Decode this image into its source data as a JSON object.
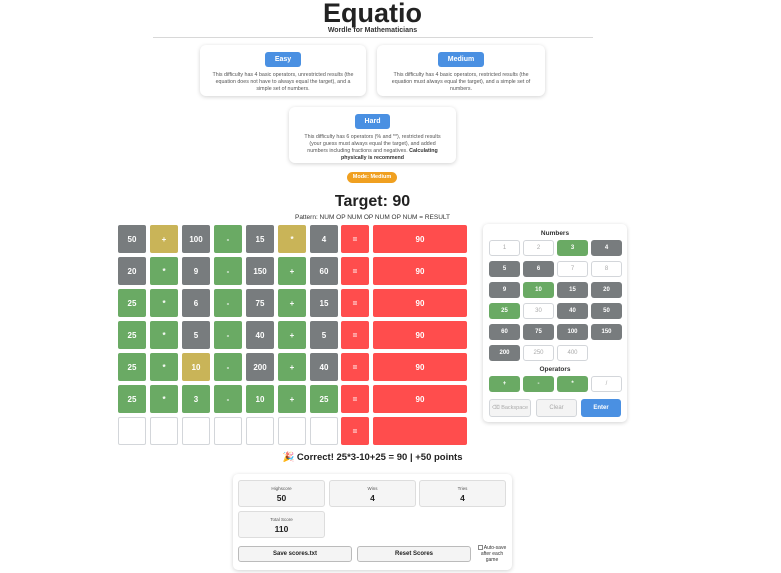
{
  "header": {
    "title": "Equatio",
    "subtitle": "Wordle for Mathematicians"
  },
  "difficulties": [
    {
      "label": "Easy",
      "description": "This difficulty has 4 basic operators, unrestricted results (the equation does not have to always equal the target), and a simple set of numbers.",
      "note": ""
    },
    {
      "label": "Medium",
      "description": "This difficulty has 4 basic operators, restricted results (the equation must always equal the target), and a simple set of numbers.",
      "note": ""
    },
    {
      "label": "Hard",
      "description": "This difficulty has 6 operators (% and **), restricted results (your guess must always equal the target), and added numbers including fractions and negatives.",
      "note": "Calculating physically is recommend"
    }
  ],
  "mode_badge": "Mode: Medium",
  "target_text": "Target: 90",
  "pattern_text": "Pattern: NUM OP NUM OP NUM OP NUM = RESULT",
  "board": {
    "rows": [
      {
        "cells": [
          {
            "v": "50",
            "s": "gray"
          },
          {
            "v": "+",
            "s": "yellow"
          },
          {
            "v": "100",
            "s": "gray"
          },
          {
            "v": "-",
            "s": "green"
          },
          {
            "v": "15",
            "s": "gray"
          },
          {
            "v": "*",
            "s": "yellow"
          },
          {
            "v": "4",
            "s": "gray"
          }
        ],
        "eq": "=",
        "result": "90"
      },
      {
        "cells": [
          {
            "v": "20",
            "s": "gray"
          },
          {
            "v": "*",
            "s": "green"
          },
          {
            "v": "9",
            "s": "gray"
          },
          {
            "v": "-",
            "s": "green"
          },
          {
            "v": "150",
            "s": "gray"
          },
          {
            "v": "+",
            "s": "green"
          },
          {
            "v": "60",
            "s": "gray"
          }
        ],
        "eq": "=",
        "result": "90"
      },
      {
        "cells": [
          {
            "v": "25",
            "s": "green"
          },
          {
            "v": "*",
            "s": "green"
          },
          {
            "v": "6",
            "s": "gray"
          },
          {
            "v": "-",
            "s": "green"
          },
          {
            "v": "75",
            "s": "gray"
          },
          {
            "v": "+",
            "s": "green"
          },
          {
            "v": "15",
            "s": "gray"
          }
        ],
        "eq": "=",
        "result": "90"
      },
      {
        "cells": [
          {
            "v": "25",
            "s": "green"
          },
          {
            "v": "*",
            "s": "green"
          },
          {
            "v": "5",
            "s": "gray"
          },
          {
            "v": "-",
            "s": "green"
          },
          {
            "v": "40",
            "s": "gray"
          },
          {
            "v": "+",
            "s": "green"
          },
          {
            "v": "5",
            "s": "gray"
          }
        ],
        "eq": "=",
        "result": "90"
      },
      {
        "cells": [
          {
            "v": "25",
            "s": "green"
          },
          {
            "v": "*",
            "s": "green"
          },
          {
            "v": "10",
            "s": "yellow"
          },
          {
            "v": "-",
            "s": "green"
          },
          {
            "v": "200",
            "s": "gray"
          },
          {
            "v": "+",
            "s": "green"
          },
          {
            "v": "40",
            "s": "gray"
          }
        ],
        "eq": "=",
        "result": "90"
      },
      {
        "cells": [
          {
            "v": "25",
            "s": "green"
          },
          {
            "v": "*",
            "s": "green"
          },
          {
            "v": "3",
            "s": "green"
          },
          {
            "v": "-",
            "s": "green"
          },
          {
            "v": "10",
            "s": "green"
          },
          {
            "v": "+",
            "s": "green"
          },
          {
            "v": "25",
            "s": "green"
          }
        ],
        "eq": "=",
        "result": "90"
      },
      {
        "cells": [
          {
            "v": "",
            "s": "empty"
          },
          {
            "v": "",
            "s": "empty"
          },
          {
            "v": "",
            "s": "empty"
          },
          {
            "v": "",
            "s": "empty"
          },
          {
            "v": "",
            "s": "empty"
          },
          {
            "v": "",
            "s": "empty"
          },
          {
            "v": "",
            "s": "empty"
          }
        ],
        "eq": "=",
        "result": ""
      }
    ]
  },
  "keyboard": {
    "numbers_title": "Numbers",
    "numbers": [
      {
        "v": "1",
        "s": "plain"
      },
      {
        "v": "2",
        "s": "plain"
      },
      {
        "v": "3",
        "s": "green"
      },
      {
        "v": "4",
        "s": "gray"
      },
      {
        "v": "5",
        "s": "gray"
      },
      {
        "v": "6",
        "s": "gray"
      },
      {
        "v": "7",
        "s": "plain"
      },
      {
        "v": "8",
        "s": "plain"
      },
      {
        "v": "9",
        "s": "gray"
      },
      {
        "v": "10",
        "s": "green"
      },
      {
        "v": "15",
        "s": "gray"
      },
      {
        "v": "20",
        "s": "gray"
      },
      {
        "v": "25",
        "s": "green"
      },
      {
        "v": "30",
        "s": "plain"
      },
      {
        "v": "40",
        "s": "gray"
      },
      {
        "v": "50",
        "s": "gray"
      },
      {
        "v": "60",
        "s": "gray"
      },
      {
        "v": "75",
        "s": "gray"
      },
      {
        "v": "100",
        "s": "gray"
      },
      {
        "v": "150",
        "s": "gray"
      },
      {
        "v": "200",
        "s": "gray"
      },
      {
        "v": "250",
        "s": "plain"
      },
      {
        "v": "400",
        "s": "plain"
      }
    ],
    "operators_title": "Operators",
    "operators": [
      {
        "v": "+",
        "s": "green"
      },
      {
        "v": "-",
        "s": "green"
      },
      {
        "v": "*",
        "s": "green"
      },
      {
        "v": "/",
        "s": "plain"
      }
    ],
    "backspace": "⌫ Backspace",
    "clear": "Clear",
    "enter": "Enter"
  },
  "message": "🎉 Correct! 25*3-10+25 = 90 | +50 points",
  "scores": {
    "highscore_label": "Highscore",
    "highscore": "50",
    "wins_label": "Wins",
    "wins": "4",
    "tries_label": "Tries",
    "tries": "4",
    "total_label": "Total Score",
    "total": "110",
    "save_label": "Save scores.txt",
    "reset_label": "Reset Scores",
    "autosave_label": "Auto-save after each game"
  },
  "colors": {
    "green": "#6aaa64",
    "yellow": "#c9b458",
    "gray": "#787c7e",
    "red": "#ff4d4d",
    "blue": "#4a90e2",
    "orange": "#f0a020"
  }
}
